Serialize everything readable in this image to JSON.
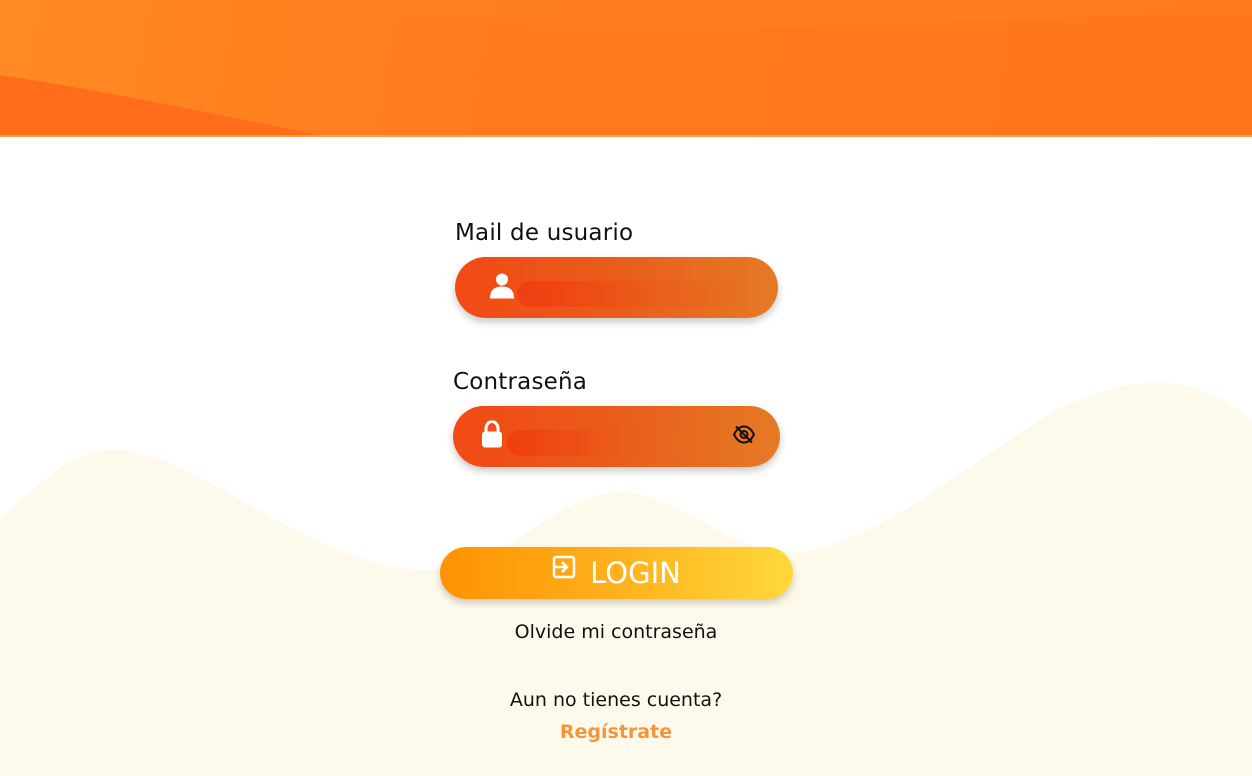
{
  "colors": {
    "header": "#ff7a1f",
    "field_gradient_start": "#f24a14",
    "field_gradient_end": "#e57a25",
    "login_gradient_start": "#ff9200",
    "login_gradient_end": "#ffd83a",
    "register_link": "#f5943a",
    "wave_background": "#fefaeb"
  },
  "email": {
    "label": "Mail de usuario",
    "value": "",
    "placeholder": "",
    "icon": "user-icon"
  },
  "password": {
    "label": "Contraseña",
    "value": "",
    "placeholder": "",
    "icon": "lock-icon",
    "toggle_icon": "eye-off-icon"
  },
  "login": {
    "label": "LOGIN",
    "icon": "login-icon"
  },
  "forgot_password": "Olvide mi contraseña",
  "no_account": "Aun no tienes cuenta?",
  "register": "Regístrate"
}
